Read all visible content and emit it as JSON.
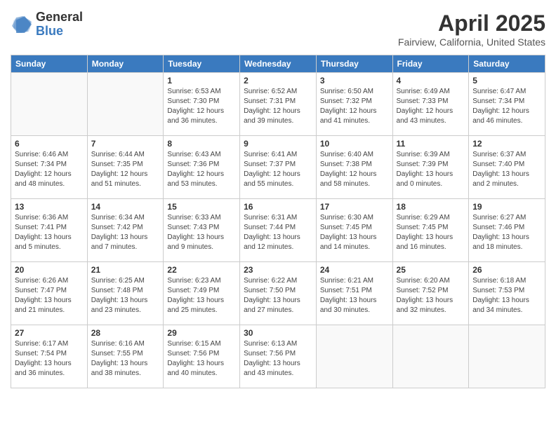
{
  "header": {
    "logo": {
      "general": "General",
      "blue": "Blue"
    },
    "title": "April 2025",
    "location": "Fairview, California, United States"
  },
  "calendar": {
    "weekdays": [
      "Sunday",
      "Monday",
      "Tuesday",
      "Wednesday",
      "Thursday",
      "Friday",
      "Saturday"
    ],
    "weeks": [
      [
        {
          "day": "",
          "info": ""
        },
        {
          "day": "",
          "info": ""
        },
        {
          "day": "1",
          "info": "Sunrise: 6:53 AM\nSunset: 7:30 PM\nDaylight: 12 hours and 36 minutes."
        },
        {
          "day": "2",
          "info": "Sunrise: 6:52 AM\nSunset: 7:31 PM\nDaylight: 12 hours and 39 minutes."
        },
        {
          "day": "3",
          "info": "Sunrise: 6:50 AM\nSunset: 7:32 PM\nDaylight: 12 hours and 41 minutes."
        },
        {
          "day": "4",
          "info": "Sunrise: 6:49 AM\nSunset: 7:33 PM\nDaylight: 12 hours and 43 minutes."
        },
        {
          "day": "5",
          "info": "Sunrise: 6:47 AM\nSunset: 7:34 PM\nDaylight: 12 hours and 46 minutes."
        }
      ],
      [
        {
          "day": "6",
          "info": "Sunrise: 6:46 AM\nSunset: 7:34 PM\nDaylight: 12 hours and 48 minutes."
        },
        {
          "day": "7",
          "info": "Sunrise: 6:44 AM\nSunset: 7:35 PM\nDaylight: 12 hours and 51 minutes."
        },
        {
          "day": "8",
          "info": "Sunrise: 6:43 AM\nSunset: 7:36 PM\nDaylight: 12 hours and 53 minutes."
        },
        {
          "day": "9",
          "info": "Sunrise: 6:41 AM\nSunset: 7:37 PM\nDaylight: 12 hours and 55 minutes."
        },
        {
          "day": "10",
          "info": "Sunrise: 6:40 AM\nSunset: 7:38 PM\nDaylight: 12 hours and 58 minutes."
        },
        {
          "day": "11",
          "info": "Sunrise: 6:39 AM\nSunset: 7:39 PM\nDaylight: 13 hours and 0 minutes."
        },
        {
          "day": "12",
          "info": "Sunrise: 6:37 AM\nSunset: 7:40 PM\nDaylight: 13 hours and 2 minutes."
        }
      ],
      [
        {
          "day": "13",
          "info": "Sunrise: 6:36 AM\nSunset: 7:41 PM\nDaylight: 13 hours and 5 minutes."
        },
        {
          "day": "14",
          "info": "Sunrise: 6:34 AM\nSunset: 7:42 PM\nDaylight: 13 hours and 7 minutes."
        },
        {
          "day": "15",
          "info": "Sunrise: 6:33 AM\nSunset: 7:43 PM\nDaylight: 13 hours and 9 minutes."
        },
        {
          "day": "16",
          "info": "Sunrise: 6:31 AM\nSunset: 7:44 PM\nDaylight: 13 hours and 12 minutes."
        },
        {
          "day": "17",
          "info": "Sunrise: 6:30 AM\nSunset: 7:45 PM\nDaylight: 13 hours and 14 minutes."
        },
        {
          "day": "18",
          "info": "Sunrise: 6:29 AM\nSunset: 7:45 PM\nDaylight: 13 hours and 16 minutes."
        },
        {
          "day": "19",
          "info": "Sunrise: 6:27 AM\nSunset: 7:46 PM\nDaylight: 13 hours and 18 minutes."
        }
      ],
      [
        {
          "day": "20",
          "info": "Sunrise: 6:26 AM\nSunset: 7:47 PM\nDaylight: 13 hours and 21 minutes."
        },
        {
          "day": "21",
          "info": "Sunrise: 6:25 AM\nSunset: 7:48 PM\nDaylight: 13 hours and 23 minutes."
        },
        {
          "day": "22",
          "info": "Sunrise: 6:23 AM\nSunset: 7:49 PM\nDaylight: 13 hours and 25 minutes."
        },
        {
          "day": "23",
          "info": "Sunrise: 6:22 AM\nSunset: 7:50 PM\nDaylight: 13 hours and 27 minutes."
        },
        {
          "day": "24",
          "info": "Sunrise: 6:21 AM\nSunset: 7:51 PM\nDaylight: 13 hours and 30 minutes."
        },
        {
          "day": "25",
          "info": "Sunrise: 6:20 AM\nSunset: 7:52 PM\nDaylight: 13 hours and 32 minutes."
        },
        {
          "day": "26",
          "info": "Sunrise: 6:18 AM\nSunset: 7:53 PM\nDaylight: 13 hours and 34 minutes."
        }
      ],
      [
        {
          "day": "27",
          "info": "Sunrise: 6:17 AM\nSunset: 7:54 PM\nDaylight: 13 hours and 36 minutes."
        },
        {
          "day": "28",
          "info": "Sunrise: 6:16 AM\nSunset: 7:55 PM\nDaylight: 13 hours and 38 minutes."
        },
        {
          "day": "29",
          "info": "Sunrise: 6:15 AM\nSunset: 7:56 PM\nDaylight: 13 hours and 40 minutes."
        },
        {
          "day": "30",
          "info": "Sunrise: 6:13 AM\nSunset: 7:56 PM\nDaylight: 13 hours and 43 minutes."
        },
        {
          "day": "",
          "info": ""
        },
        {
          "day": "",
          "info": ""
        },
        {
          "day": "",
          "info": ""
        }
      ]
    ]
  }
}
